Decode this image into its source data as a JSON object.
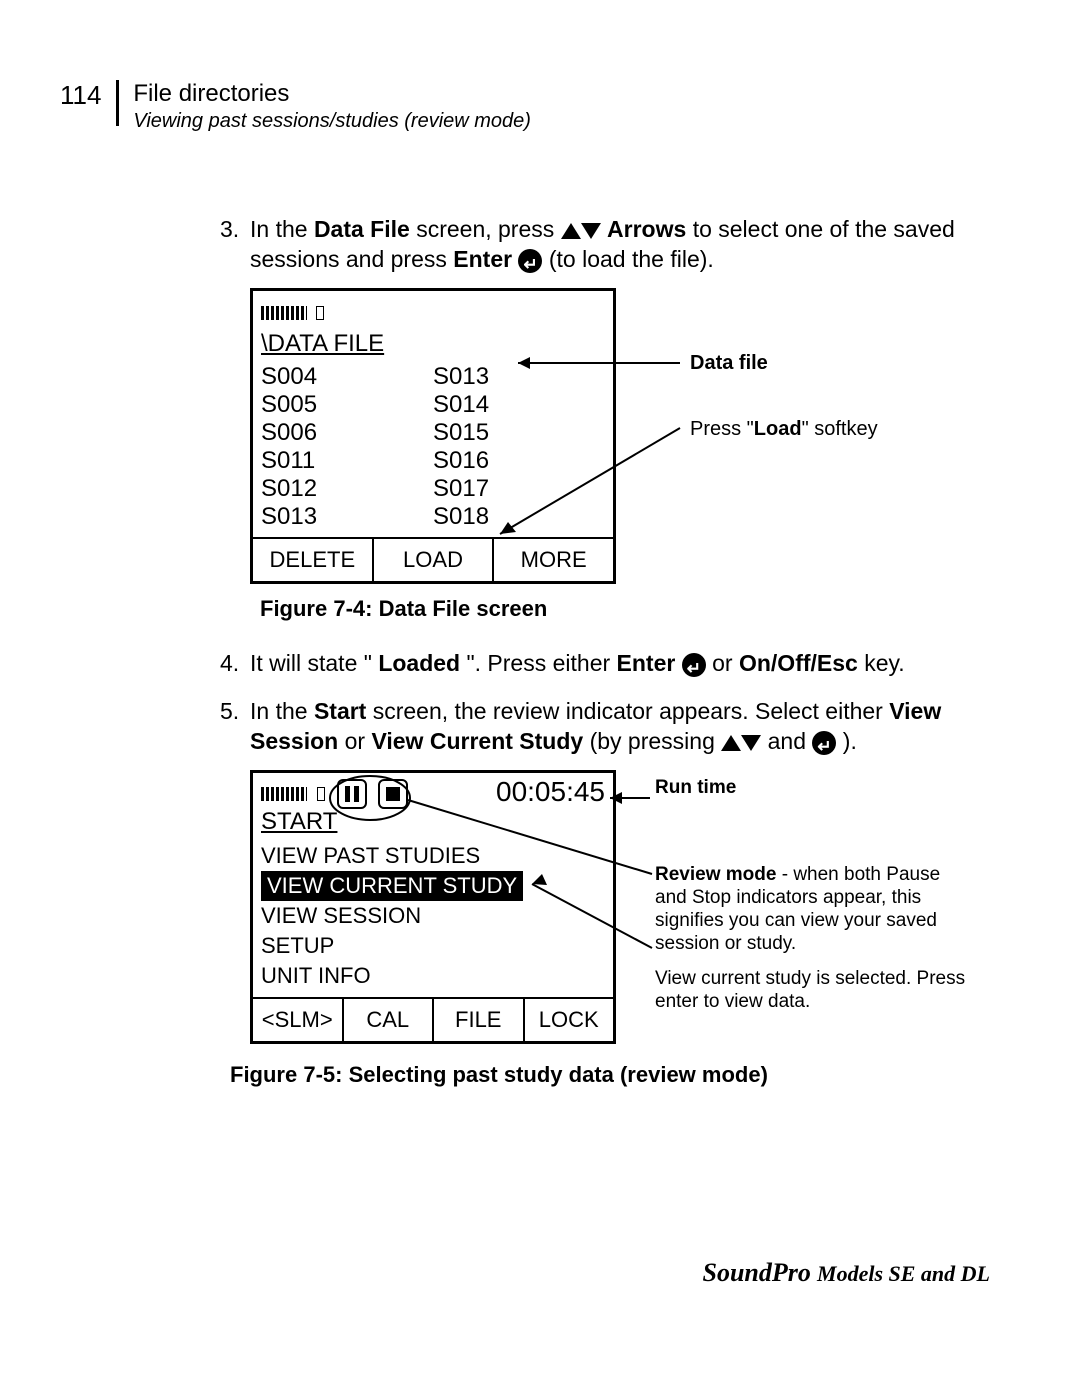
{
  "header": {
    "page_number": "114",
    "title": "File directories",
    "subtitle": "Viewing past sessions/studies (review mode)"
  },
  "step3": {
    "num": "3.",
    "text_pre": "In the ",
    "data_file": "Data File",
    "text_mid": " screen, press ",
    "arrows": "Arrows",
    "text_sel": " to select one of the saved sessions and press ",
    "enter": "Enter",
    "text_end": " (to load the file)."
  },
  "datafile_screen": {
    "title": "\\DATA FILE",
    "col1": [
      "S004",
      "S005",
      "S006",
      "S011",
      "S012",
      "S013"
    ],
    "col2": [
      "S013",
      "S014",
      "S015",
      "S016",
      "S017",
      "S018"
    ],
    "softkeys": [
      "DELETE",
      "LOAD",
      "MORE"
    ]
  },
  "callouts1": {
    "data_file": "Data file",
    "load_pre": "Press \"",
    "load_bold": "Load",
    "load_post": "\" softkey"
  },
  "fig74": "Figure 7-4:  Data File screen",
  "step4": {
    "num": "4.",
    "pre": " It will state \"",
    "loaded": "Loaded",
    "mid": "\".  Press either ",
    "enter": "Enter",
    "or": " or ",
    "onoff": "On/Off/Esc",
    "end": " key."
  },
  "step5": {
    "num": "5.",
    "pre": " In the ",
    "start": "Start",
    "mid": " screen, the review indicator appears.  Select either ",
    "viewsess": "View Session",
    "or": " or ",
    "viewcur": "View Current Study",
    "bypress": " (by pressing ",
    "and": " and ",
    "end": " )."
  },
  "start_screen": {
    "title": "START",
    "runtime": "00:05:45",
    "items": [
      "VIEW PAST STUDIES",
      "VIEW CURRENT STUDY",
      "VIEW SESSION",
      "SETUP",
      "UNIT INFO"
    ],
    "softkeys": [
      "<SLM>",
      "CAL",
      "FILE",
      "LOCK"
    ]
  },
  "callouts2": {
    "runtime_label": "Run time",
    "review_pre": "Review mode",
    "review_body": "  -  when both Pause and Stop indicators appear, this signifies you can view your saved session or study.",
    "view_cur": "View current study is selected.  Press enter to view data."
  },
  "fig75": "Figure 7-5:  Selecting past study data (review mode)",
  "footer": {
    "brand": "SoundPro",
    "models": " Models SE and DL"
  }
}
